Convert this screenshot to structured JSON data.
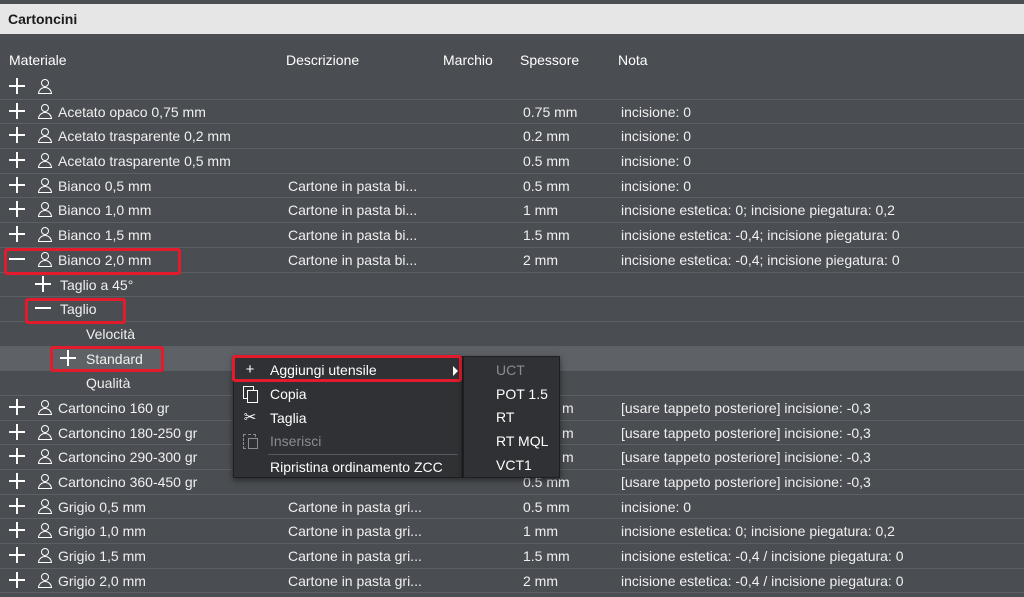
{
  "window": {
    "title": "Cartoncini"
  },
  "columns": {
    "materiale": "Materiale",
    "descrizione": "Descrizione",
    "marchio": "Marchio",
    "spessore": "Spessore",
    "nota": "Nota"
  },
  "rows": [
    {
      "name": "",
      "desc": "",
      "thick": "",
      "note": ""
    },
    {
      "name": "Acetato opaco 0,75 mm",
      "desc": "",
      "thick": "0.75 mm",
      "note": "incisione: 0"
    },
    {
      "name": "Acetato trasparente 0,2 mm",
      "desc": "",
      "thick": "0.2 mm",
      "note": "incisione: 0"
    },
    {
      "name": "Acetato trasparente 0,5 mm",
      "desc": "",
      "thick": "0.5 mm",
      "note": "incisione: 0"
    },
    {
      "name": "Bianco 0,5 mm",
      "desc": "Cartone in pasta bi...",
      "thick": "0.5 mm",
      "note": "incisione: 0"
    },
    {
      "name": "Bianco 1,0 mm",
      "desc": "Cartone in pasta bi...",
      "thick": "1 mm",
      "note": "incisione estetica: 0; incisione piegatura: 0,2"
    },
    {
      "name": "Bianco 1,5 mm",
      "desc": "Cartone in pasta bi...",
      "thick": "1.5 mm",
      "note": "incisione estetica: -0,4; incisione piegatura: 0"
    },
    {
      "name": "Bianco 2,0 mm",
      "desc": "Cartone in pasta bi...",
      "thick": "2 mm",
      "note": "incisione estetica: -0,4; incisione piegatura: 0"
    },
    {
      "name": "Taglio a 45°"
    },
    {
      "name": "Taglio"
    },
    {
      "name": "Velocità"
    },
    {
      "name": "Standard"
    },
    {
      "name": "Qualità"
    },
    {
      "name": "Cartoncino 160 gr",
      "desc": "",
      "thick": "m",
      "note": "[usare tappeto posteriore] incisione: -0,3"
    },
    {
      "name": "Cartoncino 180-250 gr",
      "desc": "",
      "thick": "m",
      "note": "[usare tappeto posteriore] incisione: -0,3"
    },
    {
      "name": "Cartoncino 290-300 gr",
      "desc": "",
      "thick": "m",
      "note": "[usare tappeto posteriore] incisione: -0,3"
    },
    {
      "name": "Cartoncino 360-450 gr",
      "desc": "",
      "thick": "0.5 mm",
      "note": "[usare tappeto posteriore] incisione: -0,3"
    },
    {
      "name": "Grigio 0,5 mm",
      "desc": "Cartone in pasta gri...",
      "thick": "0.5 mm",
      "note": "incisione: 0"
    },
    {
      "name": "Grigio 1,0 mm",
      "desc": "Cartone in pasta gri...",
      "thick": "1  mm",
      "note": "incisione estetica: 0; incisione piegatura: 0,2"
    },
    {
      "name": "Grigio 1,5 mm",
      "desc": "Cartone in pasta gri...",
      "thick": "1.5 mm",
      "note": "incisione estetica: -0,4 / incisione piegatura: 0"
    },
    {
      "name": "Grigio 2,0 mm",
      "desc": "Cartone in pasta gri...",
      "thick": "2 mm",
      "note": "incisione estetica: -0,4 / incisione piegatura: 0"
    }
  ],
  "context_menu": {
    "add_tool": "Aggiungi utensile",
    "copy": "Copia",
    "cut": "Taglia",
    "paste": "Inserisci",
    "reset_order": "Ripristina ordinamento ZCC"
  },
  "submenu": [
    "UCT",
    "POT 1.5",
    "RT",
    "RT MQL",
    "VCT1"
  ],
  "colors": {
    "highlight": "#e21b2d",
    "background": "#4a4d51",
    "menu": "#2f3134"
  }
}
